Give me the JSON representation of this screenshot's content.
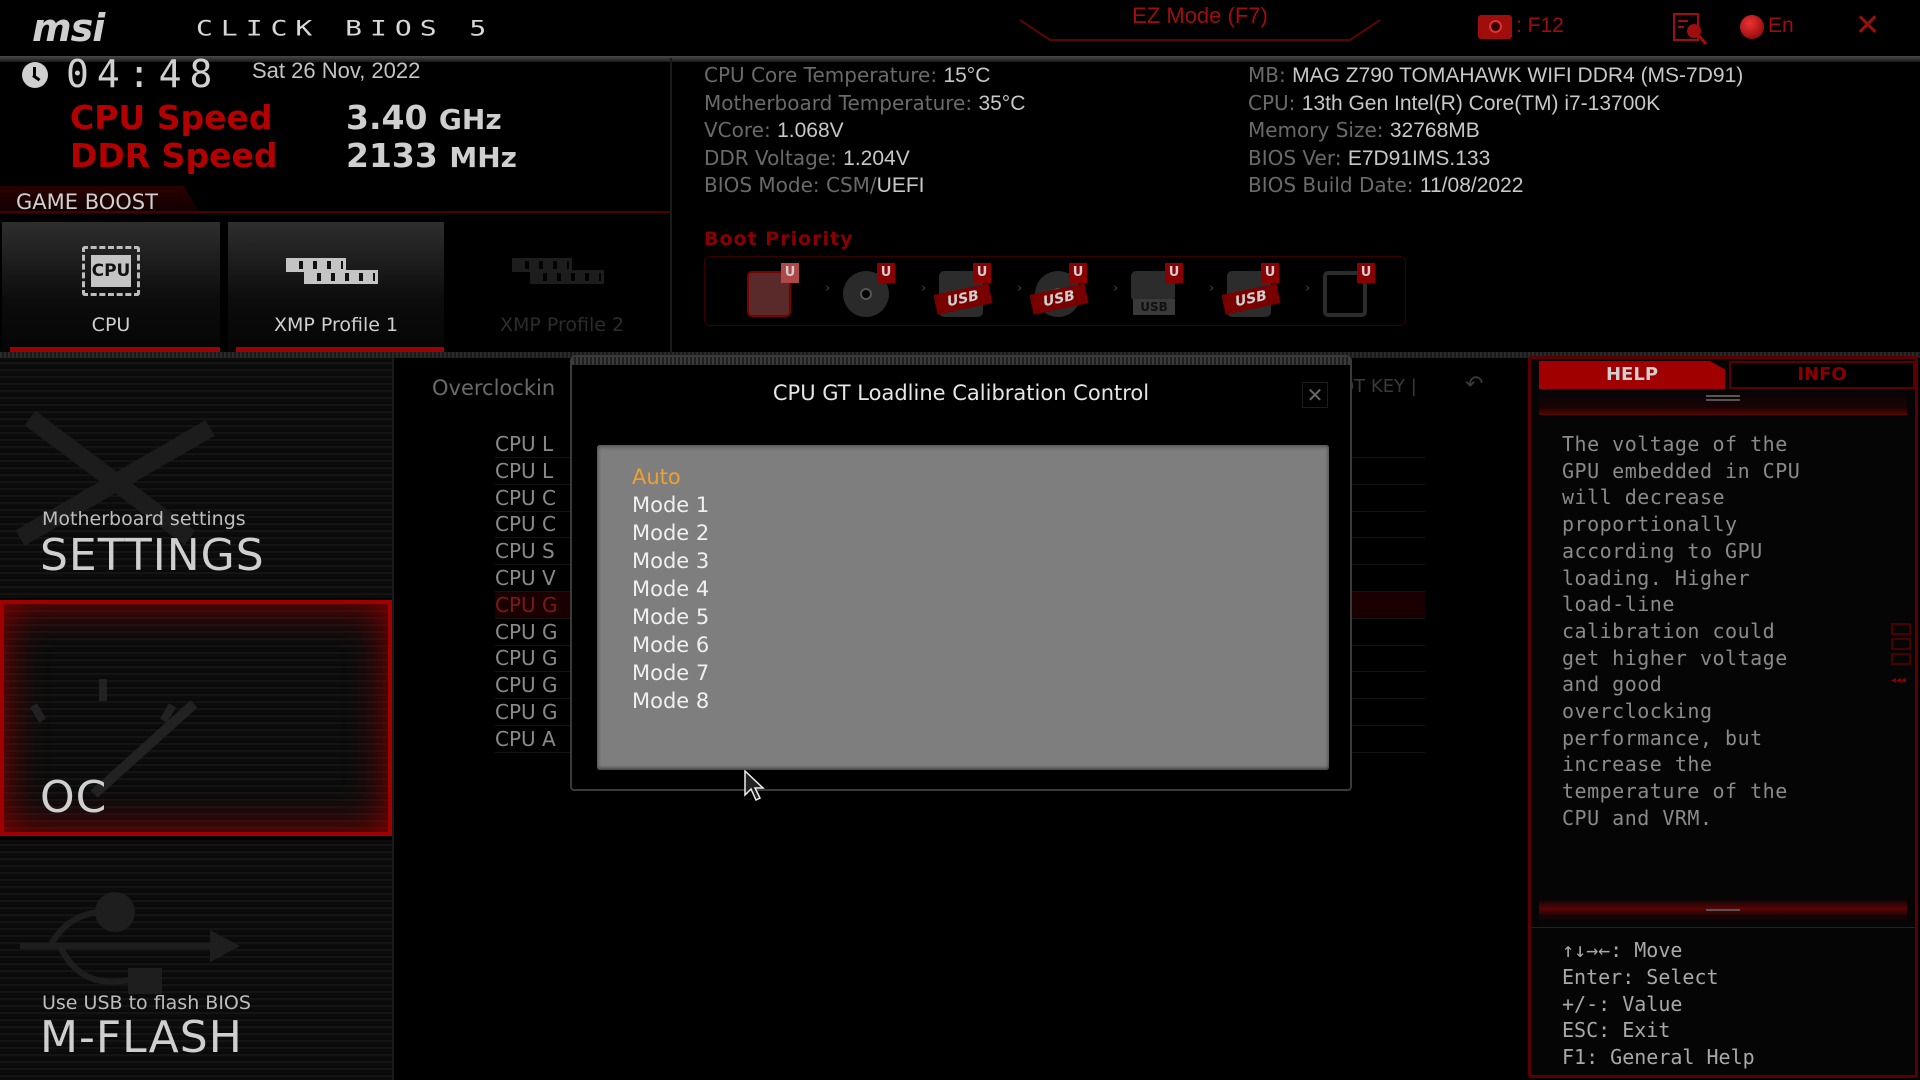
{
  "header": {
    "brand": "msi",
    "product": "CLICK BIOS 5",
    "ez_mode": "EZ Mode (F7)",
    "screenshot_key": ": F12",
    "language": "En",
    "icons": [
      "screenshot-camera-icon",
      "search-icon",
      "globe-icon",
      "close-icon"
    ]
  },
  "clock": {
    "time": "04:48",
    "date": "Sat  26 Nov, 2022"
  },
  "speeds": {
    "cpu_label": "CPU Speed",
    "cpu_value": "3.40",
    "cpu_unit": "GHz",
    "ddr_label": "DDR Speed",
    "ddr_value": "2133",
    "ddr_unit": "MHz"
  },
  "game_boost": {
    "title": "GAME BOOST",
    "tiles": [
      {
        "label": "CPU",
        "icon": "cpu-chip-icon",
        "icon_text": "CPU",
        "enabled": true
      },
      {
        "label": "XMP Profile 1",
        "icon": "ram-icon",
        "enabled": true
      },
      {
        "label": "XMP Profile 2",
        "icon": "ram-icon",
        "enabled": false
      }
    ]
  },
  "system_info": {
    "left": [
      {
        "label": "CPU Core Temperature: ",
        "value": "15°C"
      },
      {
        "label": "Motherboard Temperature: ",
        "value": "35°C"
      },
      {
        "label": "VCore: ",
        "value": "1.068V"
      },
      {
        "label": "DDR Voltage: ",
        "value": "1.204V"
      },
      {
        "label": "BIOS Mode: CSM/",
        "value": "UEFI"
      }
    ],
    "right": [
      {
        "label": "MB: ",
        "value": "MAG Z790 TOMAHAWK WIFI DDR4 (MS-7D91)"
      },
      {
        "label": "CPU: ",
        "value": "13th Gen Intel(R) Core(TM) i7-13700K"
      },
      {
        "label": "Memory Size: ",
        "value": "32768MB"
      },
      {
        "label": "BIOS Ver: ",
        "value": "E7D91IMS.133"
      },
      {
        "label": "BIOS Build Date: ",
        "value": "11/08/2022"
      }
    ]
  },
  "boot_priority": {
    "title": "Boot Priority",
    "badge": "U",
    "devices": [
      {
        "type": "hdd",
        "label": ""
      },
      {
        "type": "optical",
        "label": ""
      },
      {
        "type": "usb-hdd",
        "label": "USB"
      },
      {
        "type": "usb-optical",
        "label": "USB"
      },
      {
        "type": "usb-key",
        "label": "USB"
      },
      {
        "type": "usb-floppy",
        "label": "USB"
      },
      {
        "type": "network",
        "label": ""
      }
    ]
  },
  "nav": {
    "settings": {
      "sub": "Motherboard settings",
      "title": "SETTINGS"
    },
    "oc": {
      "title": "OC",
      "active": true
    },
    "mflash": {
      "sub": "Use USB to flash BIOS",
      "title": "M-FLASH"
    }
  },
  "overclocking": {
    "title": "Overclockin",
    "hotkey": "OT KEY  |",
    "rows": [
      "CPU L",
      "CPU L",
      "CPU C",
      "CPU C",
      "CPU S",
      "CPU V",
      "CPU G",
      "CPU G",
      "CPU G",
      "CPU G",
      "CPU G",
      "CPU A"
    ],
    "highlighted_index": 6
  },
  "modal": {
    "title": "CPU GT Loadline Calibration Control",
    "close": "✕",
    "options": [
      "Auto",
      "Mode 1",
      "Mode 2",
      "Mode 3",
      "Mode 4",
      "Mode 5",
      "Mode 6",
      "Mode 7",
      "Mode 8"
    ],
    "selected": "Auto",
    "selected_color": "#f0a030"
  },
  "help_panel": {
    "tabs": {
      "help": "HELP",
      "info": "INFO"
    },
    "text": "The voltage of the\nGPU embedded in CPU\nwill decrease\nproportionally\naccording to GPU\nloading. Higher\nload-line\ncalibration could\nget higher voltage\nand good\noverclocking\nperformance, but\nincrease the\ntemperature of the\nCPU and VRM.",
    "keys": [
      "↑↓→←: Move",
      "Enter: Select",
      "+/-: Value",
      "ESC: Exit",
      "F1: General Help"
    ]
  },
  "colors": {
    "accent": "#a00000",
    "bg": "#000000",
    "option_highlight": "#f0a030"
  }
}
